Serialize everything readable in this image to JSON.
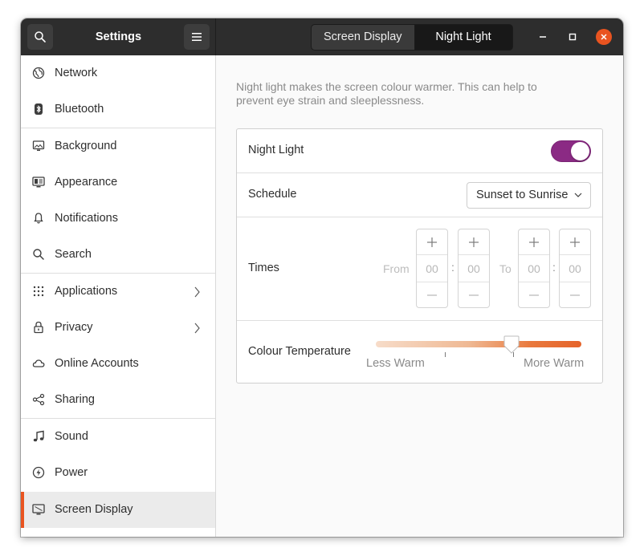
{
  "window": {
    "app_title": "Settings",
    "tabs": [
      {
        "label": "Screen Display",
        "active": false
      },
      {
        "label": "Night Light",
        "active": true
      }
    ]
  },
  "sidebar": {
    "items": [
      {
        "label": "Network",
        "icon": "globe-icon",
        "selected": false,
        "has_submenu": false
      },
      {
        "label": "Bluetooth",
        "icon": "bluetooth-icon",
        "selected": false,
        "has_submenu": false
      },
      {
        "label": "Background",
        "icon": "monitor-icon",
        "selected": false,
        "has_submenu": false
      },
      {
        "label": "Appearance",
        "icon": "appearance-icon",
        "selected": false,
        "has_submenu": false
      },
      {
        "label": "Notifications",
        "icon": "bell-icon",
        "selected": false,
        "has_submenu": false
      },
      {
        "label": "Search",
        "icon": "search-icon",
        "selected": false,
        "has_submenu": false
      },
      {
        "label": "Applications",
        "icon": "grid-icon",
        "selected": false,
        "has_submenu": true
      },
      {
        "label": "Privacy",
        "icon": "lock-icon",
        "selected": false,
        "has_submenu": true
      },
      {
        "label": "Online Accounts",
        "icon": "cloud-icon",
        "selected": false,
        "has_submenu": false
      },
      {
        "label": "Sharing",
        "icon": "share-icon",
        "selected": false,
        "has_submenu": false
      },
      {
        "label": "Sound",
        "icon": "music-note-icon",
        "selected": false,
        "has_submenu": false
      },
      {
        "label": "Power",
        "icon": "power-icon",
        "selected": false,
        "has_submenu": false
      },
      {
        "label": "Screen Display",
        "icon": "screen-display-icon",
        "selected": true,
        "has_submenu": false
      }
    ]
  },
  "main": {
    "description": "Night light makes the screen colour warmer. This can help to prevent eye strain and sleeplessness.",
    "night_light": {
      "label": "Night Light",
      "enabled": true
    },
    "schedule": {
      "label": "Schedule",
      "value": "Sunset to Sunrise"
    },
    "times": {
      "label": "Times",
      "from_label": "From",
      "to_label": "To",
      "separator": ":",
      "from_hours": "00",
      "from_minutes": "00",
      "to_hours": "00",
      "to_minutes": "00"
    },
    "colour_temperature": {
      "label": "Colour Temperature",
      "less_label": "Less Warm",
      "more_label": "More Warm",
      "value_fraction": 0.66
    }
  },
  "colors": {
    "accent": "#e95420",
    "switch_on": "#8b2a84",
    "headerbar": "#2d2d2d"
  }
}
